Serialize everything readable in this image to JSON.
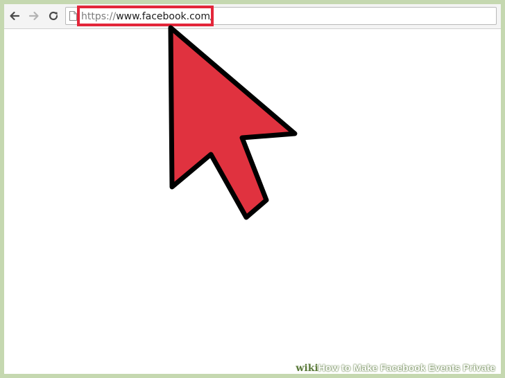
{
  "browser": {
    "toolbar": {
      "back_label": "Back",
      "forward_label": "Forward",
      "reload_label": "Reload"
    },
    "address_bar": {
      "scheme": "https://",
      "host_path": "www.facebook.com/",
      "highlighted": true,
      "highlight_color": "#e3263a"
    }
  },
  "annotation": {
    "pointer_icon": "cursor-arrow-icon",
    "pointer_color": "#e0323f",
    "pointer_outline_color": "#000000"
  },
  "watermark": {
    "wiki": "wiki",
    "how": "How",
    "title": " to Make Facebook Events Private"
  },
  "colors": {
    "frame_border": "#c5d8b0",
    "toolbar_bg": "#f4f4f4",
    "page_bg": "#ffffff"
  }
}
